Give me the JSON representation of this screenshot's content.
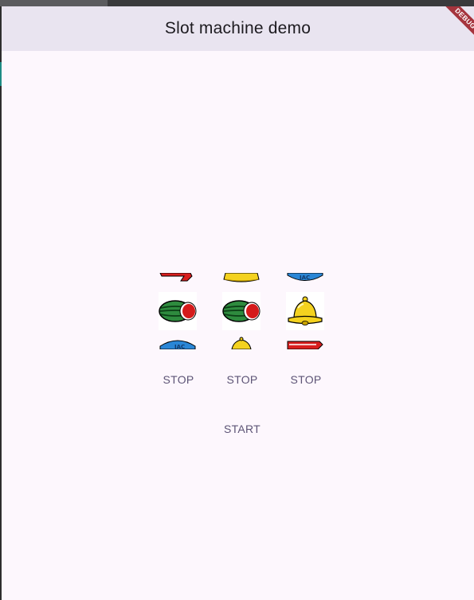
{
  "appbar": {
    "title": "Slot machine demo"
  },
  "debug_banner": {
    "label": "DEBUG"
  },
  "reels": [
    {
      "symbols": [
        "seven",
        "watermelon",
        "jac"
      ]
    },
    {
      "symbols": [
        "bell",
        "watermelon",
        "bell"
      ]
    },
    {
      "symbols": [
        "jac",
        "bell",
        "seven"
      ]
    }
  ],
  "controls": {
    "stop_labels": [
      "STOP",
      "STOP",
      "STOP"
    ],
    "start_label": "START"
  },
  "colors": {
    "background": "#fdf7fd",
    "appbar": "#e9e4f0",
    "button_text": "#5d5476",
    "debug_banner": "#a5343d"
  }
}
